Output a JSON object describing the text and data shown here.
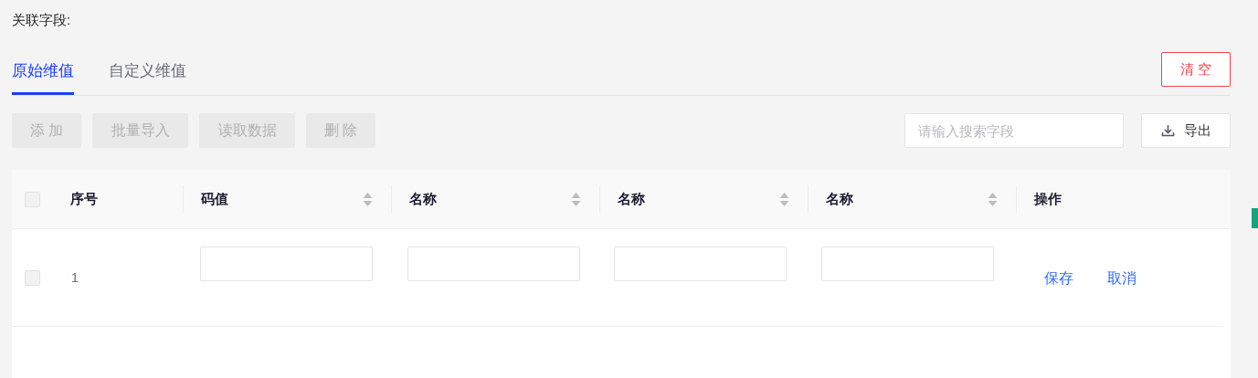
{
  "field_label": "关联字段:",
  "tabs": [
    {
      "label": "原始维值",
      "selected": true
    },
    {
      "label": "自定义维值",
      "selected": false
    }
  ],
  "clear_button": "清 空",
  "toolbar_buttons": [
    {
      "label": "添 加",
      "disabled": true
    },
    {
      "label": "批量导入",
      "disabled": true
    },
    {
      "label": "读取数据",
      "disabled": true
    },
    {
      "label": "删 除",
      "disabled": true
    }
  ],
  "search": {
    "placeholder": "请输入搜索字段"
  },
  "export_button": "导出",
  "table": {
    "header_checked": false,
    "columns": [
      {
        "kind": "index",
        "label": "序号",
        "sortable": false
      },
      {
        "kind": "field",
        "label": "码值",
        "sortable": true
      },
      {
        "kind": "field",
        "label": "名称",
        "sortable": true
      },
      {
        "kind": "field",
        "label": "名称",
        "sortable": true
      },
      {
        "kind": "field",
        "label": "名称",
        "sortable": true
      },
      {
        "kind": "actions",
        "label": "操作",
        "sortable": false
      }
    ],
    "rows": [
      {
        "checked": false,
        "index": "1",
        "actions": [
          "保存",
          "取消"
        ]
      }
    ]
  }
}
